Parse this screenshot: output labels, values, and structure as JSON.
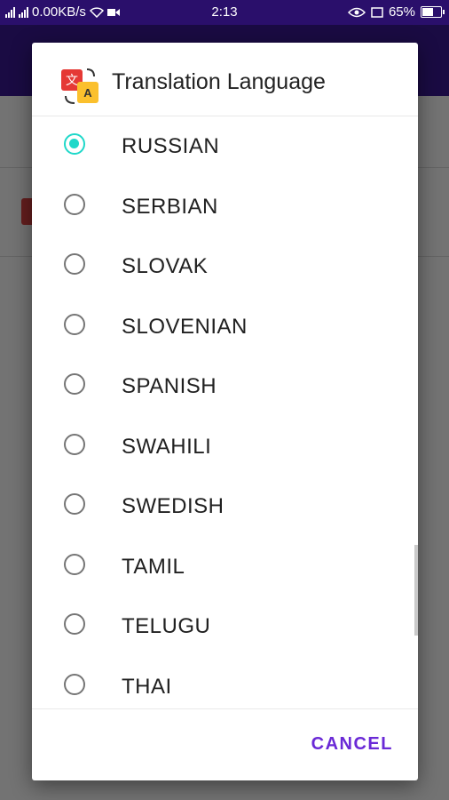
{
  "status_bar": {
    "network_speed": "0.00KB/s",
    "time": "2:13",
    "battery": "65%",
    "battery_level": 0.65,
    "icons": [
      "signal-icon",
      "signal-icon",
      "wifi-icon",
      "video-icon",
      "eye-icon",
      "cast-icon",
      "battery-icon"
    ]
  },
  "dialog": {
    "title": "Translation Language",
    "icon": "translate-icon",
    "selected": "RUSSIAN",
    "options": [
      "RUSSIAN",
      "SERBIAN",
      "SLOVAK",
      "SLOVENIAN",
      "SPANISH",
      "SWAHILI",
      "SWEDISH",
      "TAMIL",
      "TELUGU",
      "THAI"
    ],
    "cancel_label": "CANCEL"
  },
  "colors": {
    "accent_radio": "#1ed8c9",
    "button_text": "#6a29d6",
    "app_bar": "#3a1a95"
  }
}
